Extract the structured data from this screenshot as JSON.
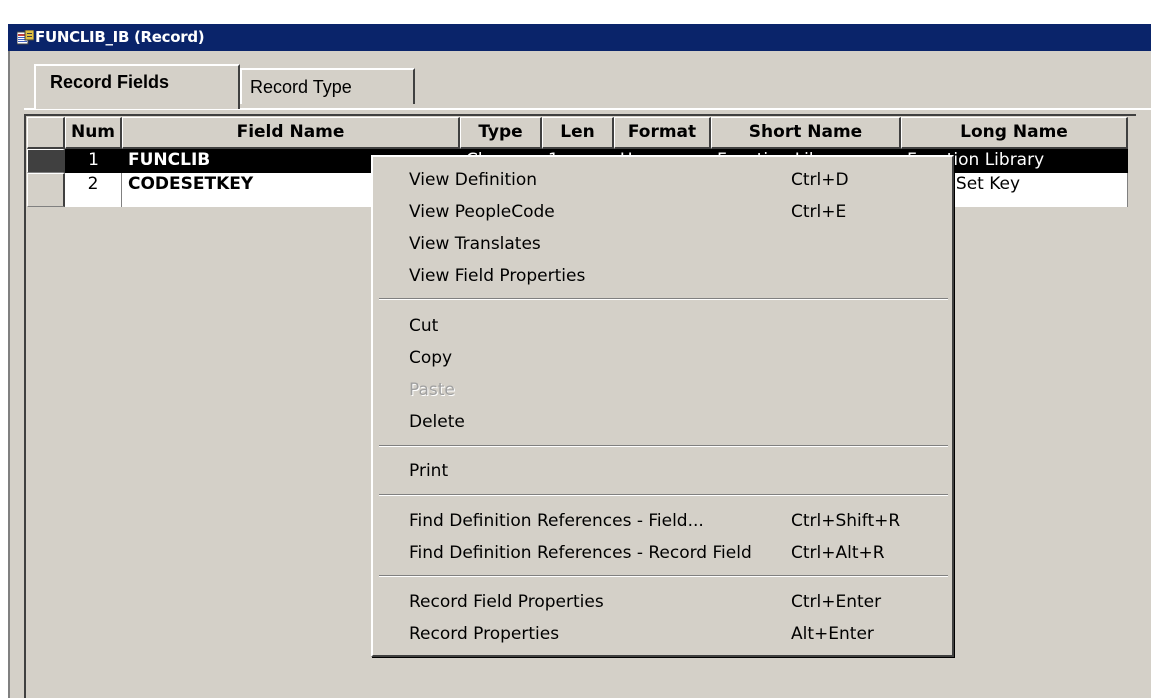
{
  "window": {
    "title": "FUNCLIB_IB (Record)"
  },
  "tabs": [
    {
      "label": "Record Fields",
      "active": true
    },
    {
      "label": "Record Type",
      "active": false
    }
  ],
  "grid": {
    "columns": [
      "Num",
      "Field Name",
      "Type",
      "Len",
      "Format",
      "Short Name",
      "Long Name"
    ],
    "rows": [
      {
        "num": "1",
        "field_name": "FUNCLIB",
        "type": "Char",
        "len": "1",
        "format": "Upper",
        "short_name": "Function Lib",
        "long_name": "Function Library",
        "selected": true
      },
      {
        "num": "2",
        "field_name": "CODESETKEY",
        "type": "",
        "len": "",
        "format": "",
        "short_name": "",
        "long_name": "Code Set Key",
        "selected": false
      }
    ]
  },
  "context_menu": {
    "groups": [
      [
        {
          "label": "View Definition",
          "shortcut": "Ctrl+D",
          "enabled": true
        },
        {
          "label": "View PeopleCode",
          "shortcut": "Ctrl+E",
          "enabled": true
        },
        {
          "label": "View Translates",
          "shortcut": "",
          "enabled": true
        },
        {
          "label": "View Field Properties",
          "shortcut": "",
          "enabled": true
        }
      ],
      [
        {
          "label": "Cut",
          "shortcut": "",
          "enabled": true
        },
        {
          "label": "Copy",
          "shortcut": "",
          "enabled": true
        },
        {
          "label": "Paste",
          "shortcut": "",
          "enabled": false
        },
        {
          "label": "Delete",
          "shortcut": "",
          "enabled": true
        }
      ],
      [
        {
          "label": "Print",
          "shortcut": "",
          "enabled": true
        }
      ],
      [
        {
          "label": "Find Definition References - Field...",
          "shortcut": "Ctrl+Shift+R",
          "enabled": true
        },
        {
          "label": "Find Definition References - Record Field",
          "shortcut": "Ctrl+Alt+R",
          "enabled": true
        }
      ],
      [
        {
          "label": "Record Field Properties",
          "shortcut": "Ctrl+Enter",
          "enabled": true
        },
        {
          "label": "Record Properties",
          "shortcut": "Alt+Enter",
          "enabled": true
        }
      ]
    ]
  },
  "colors": {
    "titlebar": "#0a246a",
    "face": "#d4d0c8",
    "selection": "#000000"
  },
  "icons": {
    "title": "record-definition-icon"
  }
}
